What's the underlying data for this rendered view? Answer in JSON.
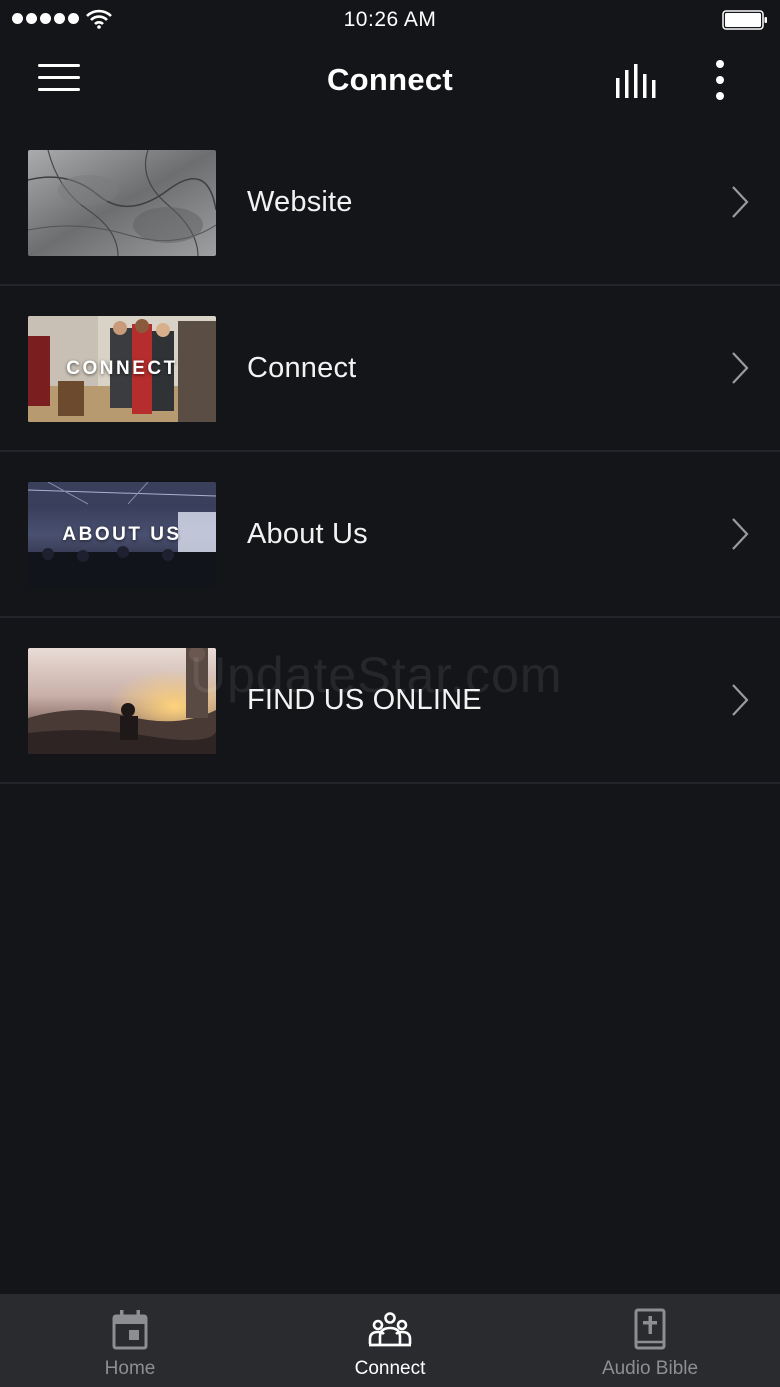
{
  "status_bar": {
    "time": "10:26 AM"
  },
  "nav": {
    "title": "Connect"
  },
  "items": [
    {
      "label": "Website",
      "thumb_caption": "",
      "thumb_style": "marble"
    },
    {
      "label": "Connect",
      "thumb_caption": "CONNECT",
      "thumb_style": "people"
    },
    {
      "label": "About Us",
      "thumb_caption": "ABOUT US",
      "thumb_style": "stage"
    },
    {
      "label": "FIND US ONLINE",
      "thumb_caption": "",
      "thumb_style": "sunset"
    }
  ],
  "watermark": "UpdateStar.com",
  "tabs": [
    {
      "label": "Home",
      "icon": "calendar-icon",
      "active": false
    },
    {
      "label": "Connect",
      "icon": "group-icon",
      "active": true
    },
    {
      "label": "Audio Bible",
      "icon": "bible-icon",
      "active": false
    }
  ],
  "colors": {
    "background": "#141518",
    "tab_bar": "#2a2b2e",
    "divider": "#23252a",
    "inactive_tab": "#8d8e91"
  }
}
